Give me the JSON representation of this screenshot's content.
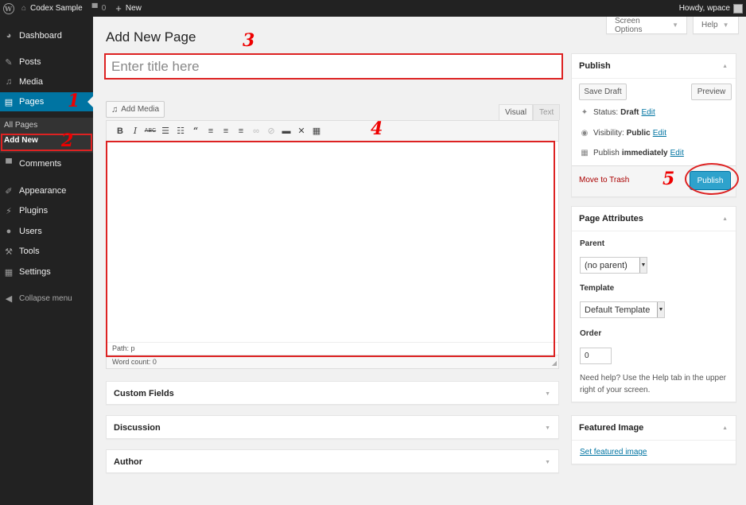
{
  "adminbar": {
    "site_name": "Codex Sample",
    "comments_count": "0",
    "new_label": "New",
    "howdy": "Howdy, wpace"
  },
  "sidebar": {
    "items": [
      {
        "label": "Dashboard",
        "icon": "dashboard-icon"
      },
      {
        "label": "Posts",
        "icon": "pin-icon"
      },
      {
        "label": "Media",
        "icon": "media-icon"
      },
      {
        "label": "Pages",
        "icon": "pages-icon"
      },
      {
        "label": "Comments",
        "icon": "comment-icon"
      },
      {
        "label": "Appearance",
        "icon": "brush-icon"
      },
      {
        "label": "Plugins",
        "icon": "plug-icon"
      },
      {
        "label": "Users",
        "icon": "user-icon"
      },
      {
        "label": "Tools",
        "icon": "wrench-icon"
      },
      {
        "label": "Settings",
        "icon": "settings-icon"
      }
    ],
    "submenu": {
      "all_pages": "All Pages",
      "add_new": "Add New"
    },
    "collapse": "Collapse menu"
  },
  "screen_options": "Screen Options",
  "help": "Help",
  "page_title": "Add New Page",
  "title_placeholder": "Enter title here",
  "editor": {
    "add_media": "Add Media",
    "tab_visual": "Visual",
    "tab_text": "Text",
    "path": "Path: p",
    "word_count": "Word count: 0"
  },
  "metaboxes": {
    "custom_fields": "Custom Fields",
    "discussion": "Discussion",
    "author": "Author"
  },
  "publish": {
    "title": "Publish",
    "save_draft": "Save Draft",
    "preview": "Preview",
    "status_label": "Status:",
    "status_value": "Draft",
    "visibility_label": "Visibility:",
    "visibility_value": "Public",
    "publish_label": "Publish",
    "publish_value": "immediately",
    "edit": "Edit",
    "trash": "Move to Trash",
    "publish_button": "Publish"
  },
  "page_attributes": {
    "title": "Page Attributes",
    "parent_label": "Parent",
    "parent_value": "(no parent)",
    "template_label": "Template",
    "template_value": "Default Template",
    "order_label": "Order",
    "order_value": "0",
    "help_text": "Need help? Use the Help tab in the upper right of your screen."
  },
  "featured_image": {
    "title": "Featured Image",
    "link": "Set featured image"
  },
  "annotations": [
    "1",
    "2",
    "3",
    "4",
    "5"
  ],
  "colors": {
    "admin_dark": "#222222",
    "accent_blue": "#0074a2",
    "publish_blue": "#2ea2cc",
    "annotation_red": "#dd0000"
  }
}
